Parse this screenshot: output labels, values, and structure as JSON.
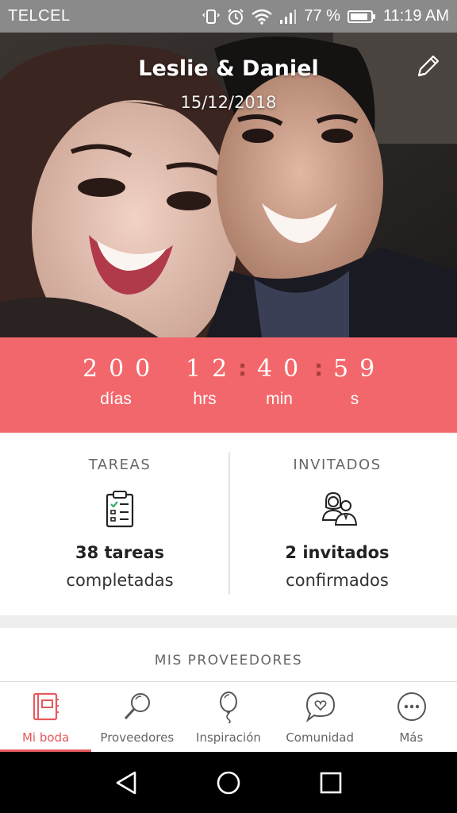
{
  "status_bar": {
    "carrier": "TELCEL",
    "battery_percent": "77 %",
    "time": "11:19 AM",
    "icons": [
      "vibrate-icon",
      "alarm-icon",
      "wifi-icon",
      "signal-icon",
      "battery-icon"
    ]
  },
  "hero": {
    "couple_names": "Leslie & Daniel",
    "wedding_date": "15/12/2018",
    "edit_icon": "pencil-icon"
  },
  "countdown": {
    "days": "200",
    "hours": "12",
    "minutes": "40",
    "seconds": "59",
    "days_label": "días",
    "hours_label": "hrs",
    "minutes_label": "min",
    "seconds_label": "s",
    "colon": ":",
    "background_color": "#f2676b"
  },
  "stats": {
    "tasks": {
      "heading": "TAREAS",
      "icon": "clipboard-checklist-icon",
      "count": "38 tareas",
      "sub": "completadas"
    },
    "guests": {
      "heading": "INVITADOS",
      "icon": "couple-guests-icon",
      "count": "2 invitados",
      "sub": "confirmados"
    }
  },
  "providers_section": {
    "title": "MIS PROVEEDORES"
  },
  "bottom_nav": {
    "accent_color": "#e65a5e",
    "items": [
      {
        "label": "Mi boda",
        "icon": "wedding-planner-icon",
        "active": true
      },
      {
        "label": "Proveedores",
        "icon": "search-icon",
        "active": false
      },
      {
        "label": "Inspiración",
        "icon": "balloon-icon",
        "active": false
      },
      {
        "label": "Comunidad",
        "icon": "chat-heart-icon",
        "active": false
      },
      {
        "label": "Más",
        "icon": "more-icon",
        "active": false
      }
    ]
  },
  "system_nav": {
    "buttons": [
      "back-icon",
      "home-icon",
      "recents-icon"
    ]
  }
}
